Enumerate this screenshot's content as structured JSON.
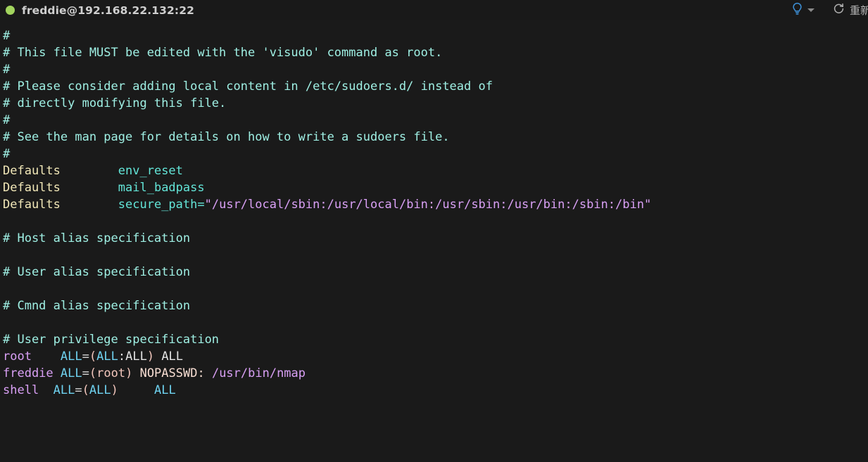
{
  "titlebar": {
    "status_dot": "connected",
    "session": "freddie@192.168.22.132:22",
    "hint_icon": "lightbulb-icon",
    "hint_dropdown_icon": "chevron-down-icon",
    "reconnect_icon": "refresh-icon",
    "reconnect_label": "重新"
  },
  "colors": {
    "background": "#1a1a1a",
    "titlebar": "#191919",
    "status_dot": "#a2d45e",
    "title_text": "#cfcfcf",
    "comment": "#9ff0e4",
    "keyword": "#f2e8b8",
    "param": "#63e5d8",
    "string": "#d9a0f5",
    "user": "#d9a0f5",
    "all": "#6fd2f0",
    "equals": "#e8e07a",
    "paren": "#f3c7bd",
    "plain": "#e3e3e3",
    "bulb": "#3d8fd6"
  },
  "terminal": {
    "file": "/etc/sudoers",
    "lines": [
      {
        "id": "l1",
        "tokens": [
          {
            "t": "#",
            "c": "comment"
          }
        ]
      },
      {
        "id": "l2",
        "tokens": [
          {
            "t": "# This file MUST be edited with the 'visudo' command as root.",
            "c": "comment"
          }
        ]
      },
      {
        "id": "l3",
        "tokens": [
          {
            "t": "#",
            "c": "comment"
          }
        ]
      },
      {
        "id": "l4",
        "tokens": [
          {
            "t": "# Please consider adding local content in /etc/sudoers.d/ instead of",
            "c": "comment"
          }
        ]
      },
      {
        "id": "l5",
        "tokens": [
          {
            "t": "# directly modifying this file.",
            "c": "comment"
          }
        ]
      },
      {
        "id": "l6",
        "tokens": [
          {
            "t": "#",
            "c": "comment"
          }
        ]
      },
      {
        "id": "l7",
        "tokens": [
          {
            "t": "# See the man page for details on how to write a sudoers file.",
            "c": "comment"
          }
        ]
      },
      {
        "id": "l8",
        "tokens": [
          {
            "t": "#",
            "c": "comment"
          }
        ]
      },
      {
        "id": "l9",
        "tokens": [
          {
            "t": "Defaults",
            "c": "keyword"
          },
          {
            "t": "        ",
            "c": "plain"
          },
          {
            "t": "env_reset",
            "c": "param"
          }
        ]
      },
      {
        "id": "l10",
        "tokens": [
          {
            "t": "Defaults",
            "c": "keyword"
          },
          {
            "t": "        ",
            "c": "plain"
          },
          {
            "t": "mail_badpass",
            "c": "param"
          }
        ]
      },
      {
        "id": "l11",
        "tokens": [
          {
            "t": "Defaults",
            "c": "keyword"
          },
          {
            "t": "        ",
            "c": "plain"
          },
          {
            "t": "secure_path",
            "c": "param"
          },
          {
            "t": "=",
            "c": "param"
          },
          {
            "t": "\"/usr/local/sbin:/usr/local/bin:/usr/sbin:/usr/bin:/sbin:/bin\"",
            "c": "string"
          }
        ]
      },
      {
        "id": "l12",
        "tokens": [
          {
            "t": "",
            "c": "plain"
          }
        ]
      },
      {
        "id": "l13",
        "tokens": [
          {
            "t": "# Host alias specification",
            "c": "comment"
          }
        ]
      },
      {
        "id": "l14",
        "tokens": [
          {
            "t": "",
            "c": "plain"
          }
        ]
      },
      {
        "id": "l15",
        "tokens": [
          {
            "t": "# User alias specification",
            "c": "comment"
          }
        ]
      },
      {
        "id": "l16",
        "tokens": [
          {
            "t": "",
            "c": "plain"
          }
        ]
      },
      {
        "id": "l17",
        "tokens": [
          {
            "t": "# Cmnd alias specification",
            "c": "comment"
          }
        ]
      },
      {
        "id": "l18",
        "tokens": [
          {
            "t": "",
            "c": "plain"
          }
        ]
      },
      {
        "id": "l19",
        "tokens": [
          {
            "t": "# User privilege specification",
            "c": "comment"
          }
        ]
      },
      {
        "id": "l20",
        "tokens": [
          {
            "t": "root",
            "c": "user"
          },
          {
            "t": "    ",
            "c": "plain"
          },
          {
            "t": "ALL",
            "c": "all"
          },
          {
            "t": "=",
            "c": "equals"
          },
          {
            "t": "(",
            "c": "paren"
          },
          {
            "t": "ALL",
            "c": "all"
          },
          {
            "t": ":",
            "c": "plain"
          },
          {
            "t": "ALL",
            "c": "plain"
          },
          {
            "t": ")",
            "c": "paren"
          },
          {
            "t": " ",
            "c": "plain"
          },
          {
            "t": "ALL",
            "c": "plain"
          }
        ]
      },
      {
        "id": "l21",
        "tokens": [
          {
            "t": "freddie",
            "c": "user"
          },
          {
            "t": " ",
            "c": "plain"
          },
          {
            "t": "ALL",
            "c": "all"
          },
          {
            "t": "=",
            "c": "equals"
          },
          {
            "t": "(",
            "c": "paren"
          },
          {
            "t": "root",
            "c": "paren"
          },
          {
            "t": ")",
            "c": "paren"
          },
          {
            "t": " ",
            "c": "plain"
          },
          {
            "t": "NOPASSWD:",
            "c": "tag"
          },
          {
            "t": " ",
            "c": "plain"
          },
          {
            "t": "/usr/bin/nmap",
            "c": "user"
          }
        ]
      },
      {
        "id": "l22",
        "tokens": [
          {
            "t": "shell",
            "c": "user"
          },
          {
            "t": "  ",
            "c": "plain"
          },
          {
            "t": "ALL",
            "c": "all"
          },
          {
            "t": "=",
            "c": "equals"
          },
          {
            "t": "(",
            "c": "paren"
          },
          {
            "t": "ALL",
            "c": "all"
          },
          {
            "t": ")",
            "c": "paren"
          },
          {
            "t": "     ",
            "c": "plain"
          },
          {
            "t": "ALL",
            "c": "all"
          }
        ]
      }
    ]
  }
}
